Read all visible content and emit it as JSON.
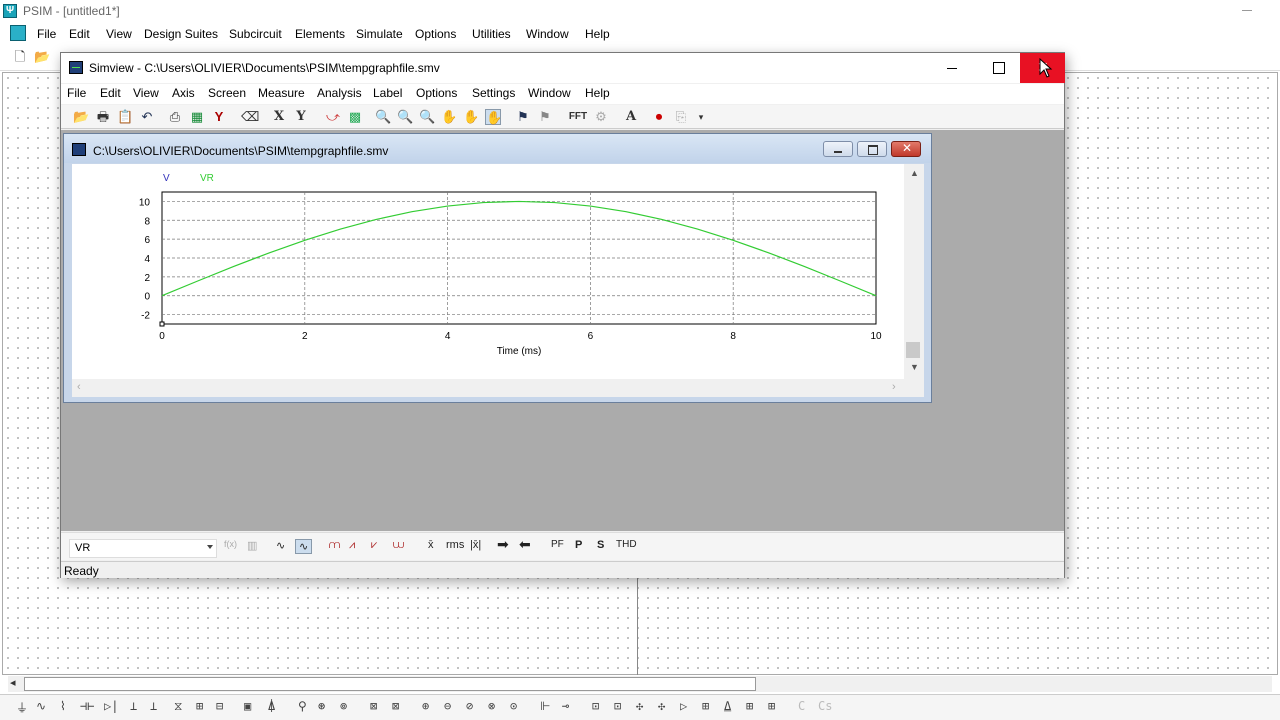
{
  "psim": {
    "title": "PSIM - [untitled1*]",
    "menu": [
      "File",
      "Edit",
      "View",
      "Design Suites",
      "Subcircuit",
      "Elements",
      "Simulate",
      "Options",
      "Utilities",
      "Window",
      "Help"
    ]
  },
  "simview": {
    "title": "Simview - C:\\Users\\OLIVIER\\Documents\\PSIM\\tempgraphfile.smv",
    "menu": [
      "File",
      "Edit",
      "View",
      "Axis",
      "Screen",
      "Measure",
      "Analysis",
      "Label",
      "Options",
      "Settings",
      "Window",
      "Help"
    ],
    "toolbar_text": {
      "x_axis": "X",
      "y_axis": "Y",
      "fft": "FFT",
      "text": "A"
    },
    "graph_window": {
      "title": "C:\\Users\\OLIVIER\\Documents\\PSIM\\tempgraphfile.smv"
    },
    "bottom_toolbar": {
      "selected_variable": "VR",
      "fx": "f(x)",
      "rms": "rms",
      "pf": "PF",
      "p": "P",
      "s": "S",
      "thd": "THD"
    },
    "status": "Ready"
  },
  "chart_data": {
    "type": "line",
    "legend": [
      "V",
      "VR"
    ],
    "xlabel": "Time (ms)",
    "ylabel": "",
    "xlim": [
      0,
      10
    ],
    "ylim": [
      -3,
      11
    ],
    "x_ticks": [
      "0",
      "2",
      "4",
      "6",
      "8",
      "10"
    ],
    "y_ticks": [
      "10",
      "8",
      "6",
      "4",
      "2",
      "0",
      "-2"
    ],
    "grid": true,
    "series": [
      {
        "name": "VR",
        "color": "#33cc33",
        "x": [
          0,
          0.5,
          1,
          1.5,
          2,
          2.5,
          3,
          3.5,
          4,
          4.5,
          5,
          5.5,
          6,
          6.5,
          7,
          7.5,
          8,
          8.5,
          9,
          9.5,
          10
        ],
        "y": [
          0,
          1.56,
          3.09,
          4.54,
          5.88,
          7.07,
          8.09,
          8.91,
          9.51,
          9.88,
          10,
          9.88,
          9.51,
          8.91,
          8.09,
          7.07,
          5.88,
          4.54,
          3.09,
          1.56,
          0
        ]
      }
    ]
  }
}
